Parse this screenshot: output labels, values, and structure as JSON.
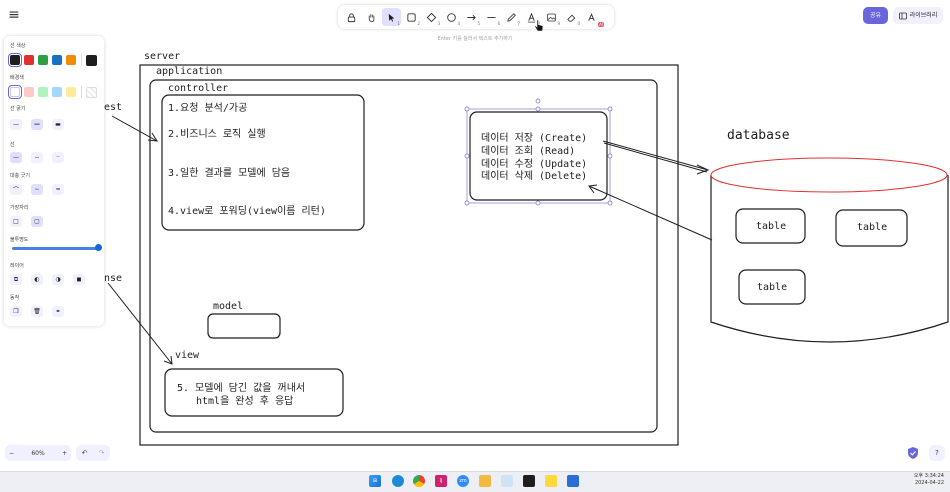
{
  "toolbar": {
    "tools": [
      {
        "name": "lock-icon",
        "key": ""
      },
      {
        "name": "hand-icon",
        "key": ""
      },
      {
        "name": "selection-icon",
        "key": "1"
      },
      {
        "name": "rectangle-icon",
        "key": "2"
      },
      {
        "name": "diamond-icon",
        "key": "3"
      },
      {
        "name": "ellipse-icon",
        "key": "4"
      },
      {
        "name": "arrow-icon",
        "key": "5"
      },
      {
        "name": "line-icon",
        "key": "6"
      },
      {
        "name": "pencil-icon",
        "key": "7"
      },
      {
        "name": "text-icon",
        "key": "8"
      },
      {
        "name": "image-icon",
        "key": "9"
      },
      {
        "name": "eraser-icon",
        "key": "0"
      },
      {
        "name": "more-tools-icon",
        "key": "AI"
      }
    ],
    "hint": "Enter 키를 눌러서 텍스트 추가하기"
  },
  "topright": {
    "share_label": "공유",
    "library_label": "라이브러리"
  },
  "panel": {
    "stroke_color_label": "선 색상",
    "stroke_colors": [
      "#1e1e1e",
      "#e03131",
      "#2f9e44",
      "#1971c2",
      "#f08c00"
    ],
    "stroke_current": "#1e1e1e",
    "background_label": "배경색",
    "background_colors": [
      "#ffffff",
      "#ffc9c9",
      "#b2f2bb",
      "#a5d8ff",
      "#ffec99"
    ],
    "stroke_width_label": "선 굵기",
    "stroke_style_label": "선",
    "sloppiness_label": "대충 긋기",
    "edges_label": "가장자리",
    "opacity_label": "불투명도",
    "opacity_value": 100,
    "layers_label": "레이어",
    "actions_label": "동작"
  },
  "canvas": {
    "server_label": "server",
    "application_label": "application",
    "controller_label": "controller",
    "controller_steps": [
      "1.요청 분석/가공",
      "2.비즈니스 로직 실행",
      "3.일한 결과를 모델에 담음",
      "4.view로 포워딩(view이름 리턴)"
    ],
    "service_lines": [
      "데이터 저장 (Create)",
      "데이터 조회 (Read)",
      "데이터 수정 (Update)",
      "데이터 삭제 (Delete)"
    ],
    "database_label": "database",
    "tables": [
      "table",
      "table",
      "table"
    ],
    "model_label": "model",
    "view_label": "view",
    "view_text": [
      "5. 모델에 담긴 값을 꺼내서",
      "html을 완성 후 응답"
    ],
    "request_label_partial": "est",
    "response_label_partial": "nse"
  },
  "bottom": {
    "zoom_label": "60%",
    "zoom_out": "−",
    "zoom_in": "+",
    "undo": "↶",
    "redo": "↷",
    "help": "?"
  },
  "taskbar": {
    "time": "오후 3:34:24",
    "date": "2024-04-22"
  }
}
